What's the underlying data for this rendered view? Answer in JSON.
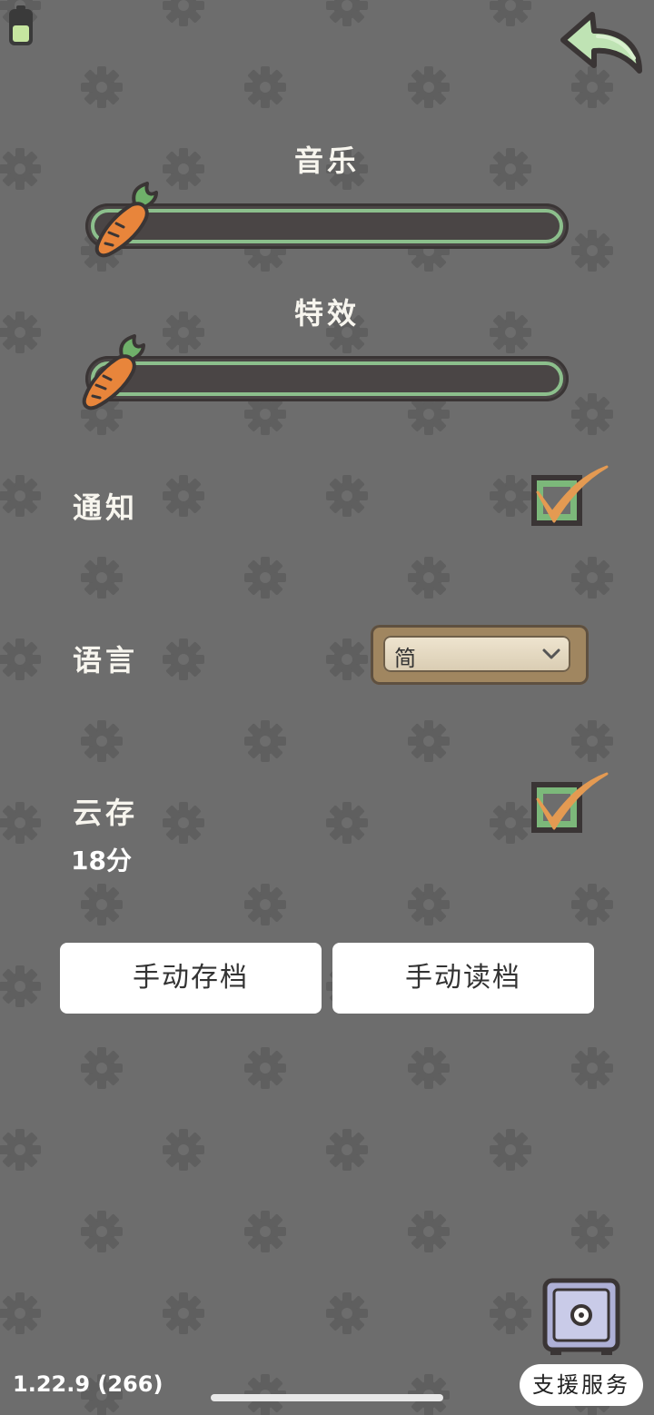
{
  "settings": {
    "music": {
      "title": "音乐",
      "level": 0.0
    },
    "sfx": {
      "title": "特效",
      "level": 0.0
    },
    "notification": {
      "label": "通知",
      "checked": true
    },
    "language": {
      "label": "语言",
      "selected": "简"
    },
    "cloud_save": {
      "label": "云存",
      "checked": true,
      "last_sync": "18分"
    },
    "buttons": {
      "manual_save": "手动存档",
      "manual_load": "手动读档"
    },
    "support": {
      "label": "支援服务"
    },
    "version": "1.22.9 (266)"
  },
  "icons": {
    "top_left": "battery-icon",
    "top_right": "back-arrow-icon",
    "slider_thumb": "carrot-icon",
    "checkbox": "checkmark-icon",
    "dropdown": "chevron-down-icon",
    "support": "safe-icon"
  },
  "colors": {
    "background": "#6d6d6d",
    "track_green": "#8cbf8c",
    "carrot_orange": "#e8853b",
    "check_orange": "#e49a52",
    "dropdown_frame": "#a08660"
  }
}
